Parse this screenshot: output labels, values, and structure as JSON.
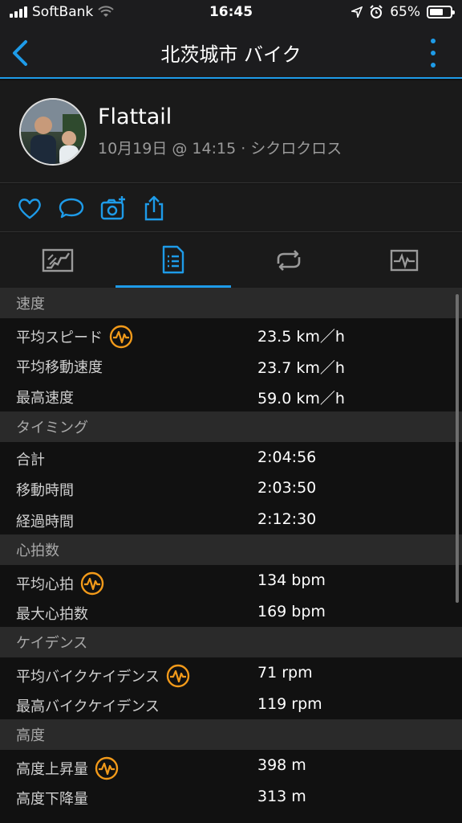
{
  "status": {
    "carrier": "SoftBank",
    "time": "16:45",
    "battery": "65%",
    "battery_level": 0.65
  },
  "nav": {
    "title": "北茨城市 バイク",
    "accent": "#1e9be8"
  },
  "profile": {
    "name": "Flattail",
    "subtitle": "10月19日 @ 14:15 · シクロクロス"
  },
  "sections": [
    {
      "title": "速度",
      "rows": [
        {
          "label": "平均スピード",
          "value": "23.5 km／h",
          "icon": "heart-rate-icon"
        },
        {
          "label": "平均移動速度",
          "value": "23.7 km／h"
        },
        {
          "label": "最高速度",
          "value": "59.0 km／h"
        }
      ]
    },
    {
      "title": "タイミング",
      "rows": [
        {
          "label": "合計",
          "value": "2:04:56"
        },
        {
          "label": "移動時間",
          "value": "2:03:50"
        },
        {
          "label": "経過時間",
          "value": "2:12:30"
        }
      ]
    },
    {
      "title": "心拍数",
      "rows": [
        {
          "label": "平均心拍",
          "value": "134 bpm",
          "icon": "heart-rate-icon"
        },
        {
          "label": "最大心拍数",
          "value": "169 bpm"
        }
      ]
    },
    {
      "title": "ケイデンス",
      "rows": [
        {
          "label": "平均バイクケイデンス",
          "value": "71 rpm",
          "icon": "heart-rate-icon"
        },
        {
          "label": "最高バイクケイデンス",
          "value": "119 rpm"
        }
      ]
    },
    {
      "title": "高度",
      "rows": [
        {
          "label": "高度上昇量",
          "value": "398 m",
          "icon": "heart-rate-icon"
        },
        {
          "label": "高度下降量",
          "value": "313 m"
        }
      ]
    }
  ]
}
